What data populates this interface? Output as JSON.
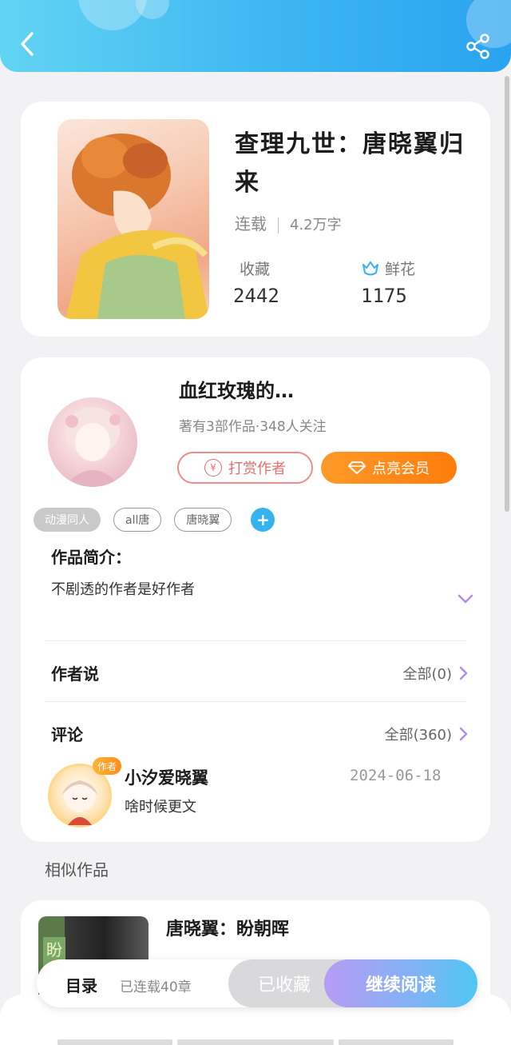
{
  "header": {
    "back_icon": "chevron-left-icon",
    "share_icon": "share-icon",
    "gradient": [
      "#62d4f3",
      "#2aa3f0"
    ]
  },
  "book": {
    "title": "查理九世：唐晓翼归来",
    "status": "连载",
    "word_count": "4.2万字",
    "favorites_label": "收藏",
    "favorites_value": "2442",
    "flowers_label": "鲜花",
    "flowers_value": "1175",
    "flower_icon": "flower-icon"
  },
  "author": {
    "name": "血红玫瑰的…",
    "stats": "著有3部作品·348人关注",
    "reward_label": "打赏作者",
    "vip_label": "点亮会员",
    "reward_icon": "yen-icon",
    "vip_icon": "diamond-icon"
  },
  "tags": [
    "动漫同人",
    "all唐",
    "唐晓翼"
  ],
  "intro": {
    "title": "作品简介：",
    "text": "不剧透的作者是好作者"
  },
  "author_says": {
    "title": "作者说",
    "link": "全部(0)"
  },
  "comments": {
    "title": "评论",
    "link": "全部(360)",
    "items": [
      {
        "badge": "作者",
        "user": "小汐爱晓翼",
        "date": "2024-06-18",
        "text": "啥时候更文"
      }
    ]
  },
  "similar": {
    "heading": "相似作品",
    "items": [
      {
        "cover_label": "盼",
        "title": "唐晓翼：盼朝晖"
      }
    ]
  },
  "bottom_bar": {
    "toc_label": "目录",
    "toc_count": "已连载40章",
    "collected_label": "已收藏",
    "continue_label": "继续阅读"
  },
  "colors": {
    "accent": "#36b3ee",
    "vip": "#ff8b1a",
    "reward": "#e46f6f",
    "continue_gradient": [
      "#b79cf4",
      "#4fc7f3"
    ]
  }
}
